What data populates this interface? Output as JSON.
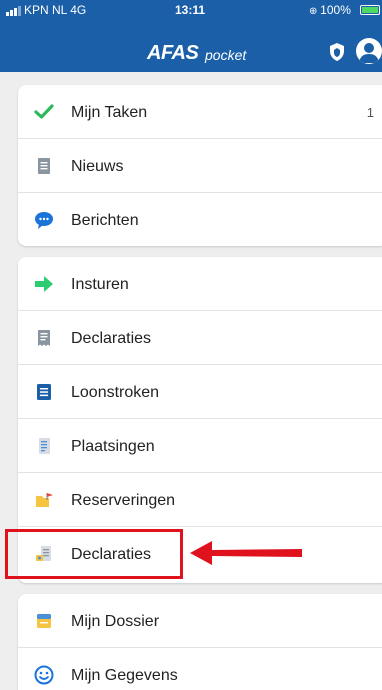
{
  "status_bar": {
    "carrier": "KPN NL  4G",
    "time": "13:11",
    "battery": "100%"
  },
  "header": {
    "brand": "AFAS",
    "brand_suffix": "pocket",
    "shield_icon": "shield-icon",
    "profile_icon": "user-avatar-icon",
    "color": "#1b5fa9"
  },
  "groups": [
    {
      "items": [
        {
          "label": "Mijn Taken",
          "icon": "checkmark-icon",
          "badge": "1"
        },
        {
          "label": "Nieuws",
          "icon": "document-icon"
        },
        {
          "label": "Berichten",
          "icon": "chat-bubble-icon"
        }
      ]
    },
    {
      "items": [
        {
          "label": "Insturen",
          "icon": "arrow-right-icon"
        },
        {
          "label": "Declaraties",
          "icon": "receipt-icon"
        },
        {
          "label": "Loonstroken",
          "icon": "payslip-icon"
        },
        {
          "label": "Plaatsingen",
          "icon": "clipboard-icon"
        },
        {
          "label": "Reserveringen",
          "icon": "folder-flag-icon"
        },
        {
          "label": "Declaraties",
          "icon": "expense-form-icon"
        }
      ]
    },
    {
      "items": [
        {
          "label": "Mijn Dossier",
          "icon": "dossier-icon"
        },
        {
          "label": "Mijn Gegevens",
          "icon": "smiley-icon"
        }
      ]
    }
  ],
  "annotation": {
    "highlight_color": "#e0121d",
    "highlighted_item": "Declaraties"
  }
}
